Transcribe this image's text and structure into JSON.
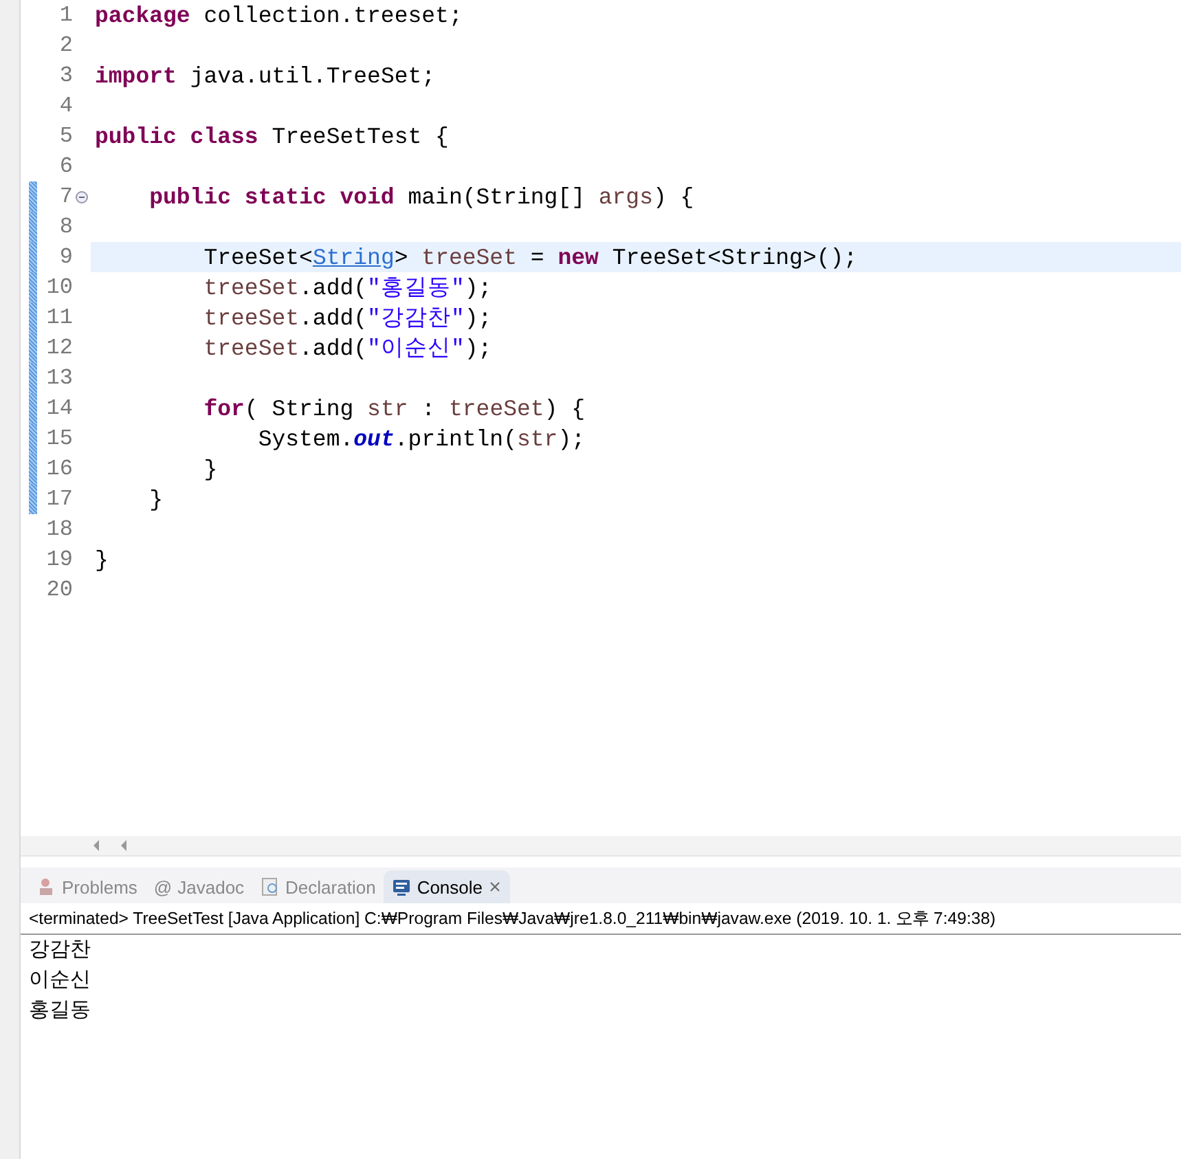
{
  "editor": {
    "lines": [
      {
        "number": "1",
        "changed": false,
        "current": false,
        "foldable": false,
        "tokens": [
          {
            "kind": "kw",
            "text": "package"
          },
          {
            "kind": "plain",
            "text": " collection.treeset;"
          }
        ]
      },
      {
        "number": "2",
        "changed": false,
        "current": false,
        "foldable": false
      },
      {
        "number": "3",
        "changed": false,
        "current": false,
        "foldable": false,
        "tokens": [
          {
            "kind": "kw",
            "text": "import"
          },
          {
            "kind": "plain",
            "text": " java.util.TreeSet;"
          }
        ]
      },
      {
        "number": "4",
        "changed": false,
        "current": false,
        "foldable": false
      },
      {
        "number": "5",
        "changed": false,
        "current": false,
        "foldable": false,
        "tokens": [
          {
            "kind": "kw",
            "text": "public class"
          },
          {
            "kind": "plain",
            "text": " TreeSetTest {"
          }
        ]
      },
      {
        "number": "6",
        "changed": false,
        "current": false,
        "foldable": false
      },
      {
        "number": "7",
        "changed": true,
        "current": false,
        "foldable": true,
        "tokens": [
          {
            "kind": "kw",
            "text": "    public static void"
          },
          {
            "kind": "plain",
            "text": " main(String[] "
          },
          {
            "kind": "var",
            "text": "args"
          },
          {
            "kind": "plain",
            "text": ") {"
          }
        ]
      },
      {
        "number": "8",
        "changed": true,
        "current": false,
        "foldable": false
      },
      {
        "number": "9",
        "changed": true,
        "current": true,
        "foldable": false,
        "tokens": [
          {
            "kind": "plain",
            "text": "        TreeSet<"
          },
          {
            "kind": "link",
            "text": "String"
          },
          {
            "kind": "plain",
            "text": "> "
          },
          {
            "kind": "var",
            "text": "treeSet"
          },
          {
            "kind": "plain",
            "text": " = "
          },
          {
            "kind": "kw",
            "text": "new"
          },
          {
            "kind": "plain",
            "text": " TreeSet<String>();"
          }
        ]
      },
      {
        "number": "10",
        "changed": true,
        "current": false,
        "foldable": false,
        "tokens": [
          {
            "kind": "var",
            "text": "        treeSet"
          },
          {
            "kind": "plain",
            "text": ".add("
          },
          {
            "kind": "str",
            "text": "\"홍길동\""
          },
          {
            "kind": "plain",
            "text": ");"
          }
        ]
      },
      {
        "number": "11",
        "changed": true,
        "current": false,
        "foldable": false,
        "tokens": [
          {
            "kind": "var",
            "text": "        treeSet"
          },
          {
            "kind": "plain",
            "text": ".add("
          },
          {
            "kind": "str",
            "text": "\"강감찬\""
          },
          {
            "kind": "plain",
            "text": ");"
          }
        ]
      },
      {
        "number": "12",
        "changed": true,
        "current": false,
        "foldable": false,
        "tokens": [
          {
            "kind": "var",
            "text": "        treeSet"
          },
          {
            "kind": "plain",
            "text": ".add("
          },
          {
            "kind": "str",
            "text": "\"이순신\""
          },
          {
            "kind": "plain",
            "text": ");"
          }
        ]
      },
      {
        "number": "13",
        "changed": true,
        "current": false,
        "foldable": false
      },
      {
        "number": "14",
        "changed": true,
        "current": false,
        "foldable": false,
        "tokens": [
          {
            "kind": "kw",
            "text": "        for"
          },
          {
            "kind": "plain",
            "text": "( String "
          },
          {
            "kind": "var",
            "text": "str"
          },
          {
            "kind": "plain",
            "text": " : "
          },
          {
            "kind": "var",
            "text": "treeSet"
          },
          {
            "kind": "plain",
            "text": ") {"
          }
        ]
      },
      {
        "number": "15",
        "changed": true,
        "current": false,
        "foldable": false,
        "tokens": [
          {
            "kind": "plain",
            "text": "            System."
          },
          {
            "kind": "static",
            "text": "out"
          },
          {
            "kind": "plain",
            "text": ".println("
          },
          {
            "kind": "var",
            "text": "str"
          },
          {
            "kind": "plain",
            "text": ");"
          }
        ]
      },
      {
        "number": "16",
        "changed": true,
        "current": false,
        "foldable": false,
        "tokens": [
          {
            "kind": "plain",
            "text": "        }"
          }
        ]
      },
      {
        "number": "17",
        "changed": true,
        "current": false,
        "foldable": false,
        "tokens": [
          {
            "kind": "plain",
            "text": "    }"
          }
        ]
      },
      {
        "number": "18",
        "changed": false,
        "current": false,
        "foldable": false
      },
      {
        "number": "19",
        "changed": false,
        "current": false,
        "foldable": false,
        "tokens": [
          {
            "kind": "plain",
            "text": "}"
          }
        ]
      },
      {
        "number": "20",
        "changed": false,
        "current": false,
        "foldable": false
      }
    ]
  },
  "views": {
    "tabs": [
      {
        "label": "Problems",
        "selected": false
      },
      {
        "prefix": "@",
        "label": "Javadoc",
        "selected": false
      },
      {
        "label": "Declaration",
        "selected": false
      },
      {
        "label": "Console",
        "selected": true
      }
    ]
  },
  "console": {
    "header": "<terminated> TreeSetTest [Java Application] C:₩Program Files₩Java₩jre1.8.0_211₩bin₩javaw.exe (2019. 10. 1. 오후 7:49:38)",
    "output": [
      "강감찬",
      "이순신",
      "홍길동"
    ]
  }
}
